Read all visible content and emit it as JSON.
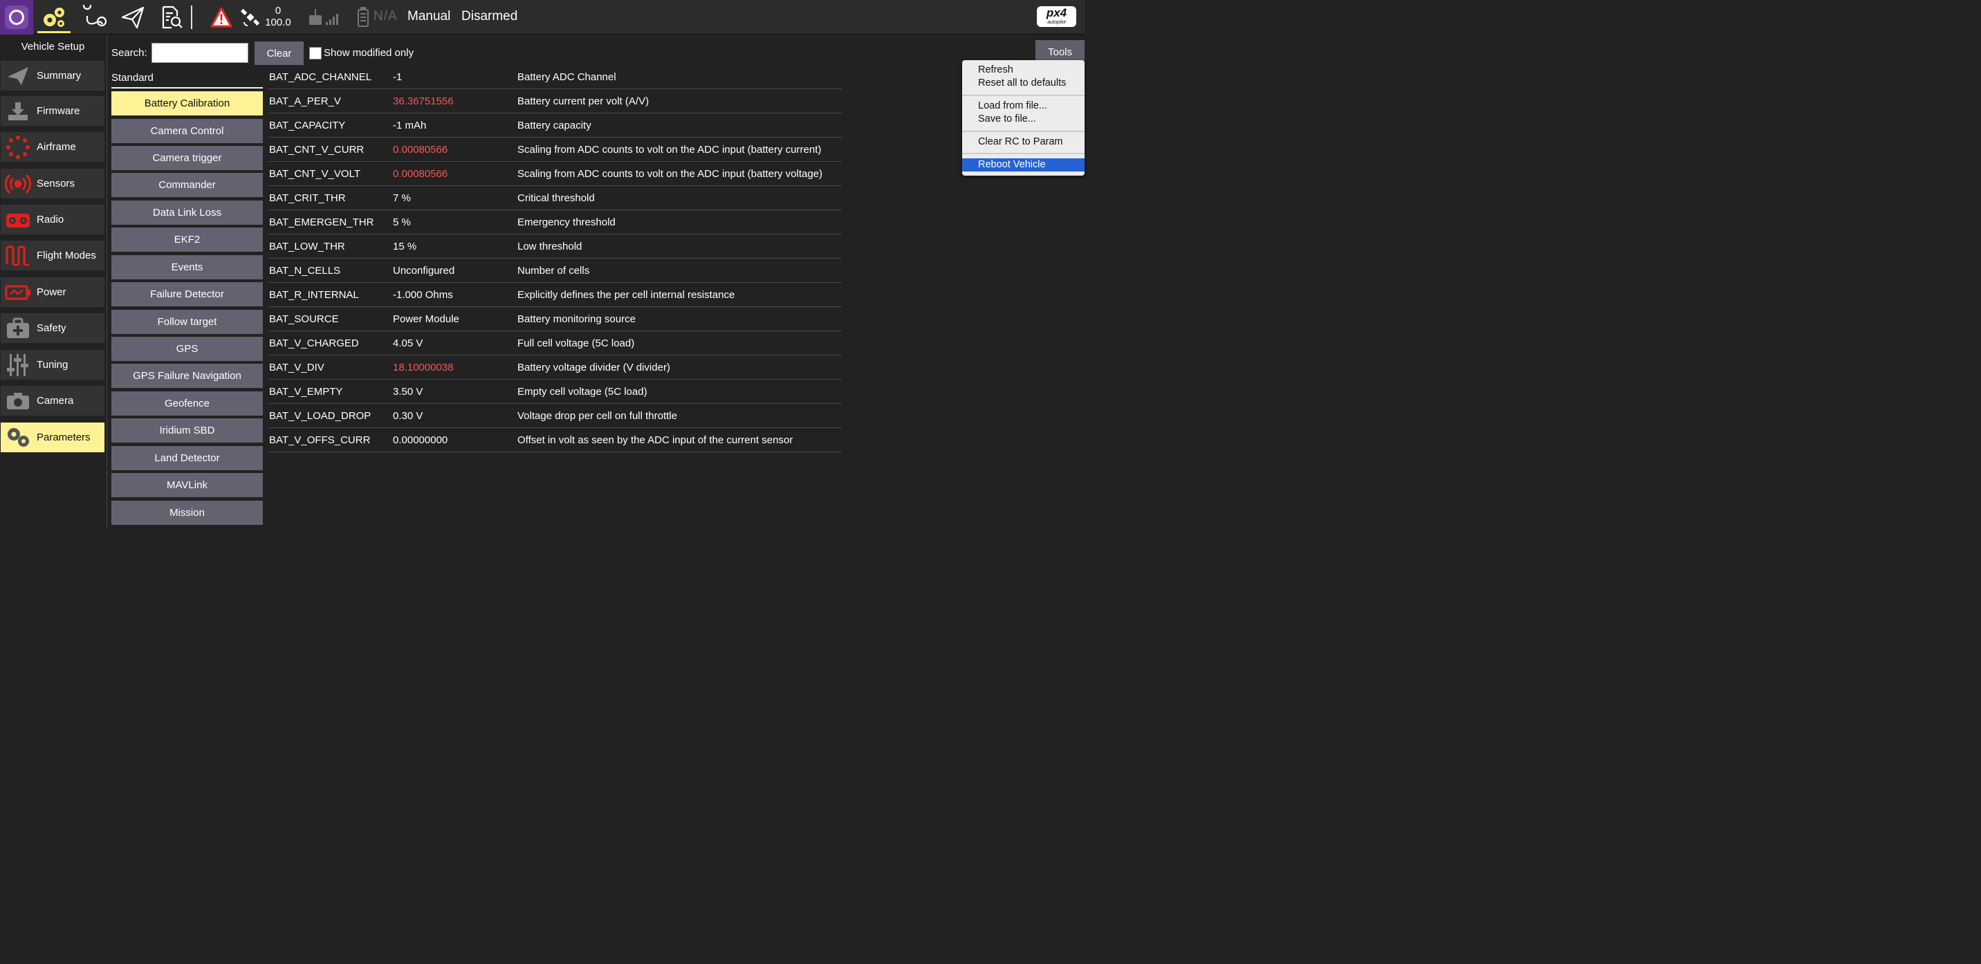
{
  "toolbar": {
    "gps_count": "0",
    "gps_hdop": "100.0",
    "battery_text": "N/A",
    "flight_mode": "Manual",
    "arm_state": "Disarmed",
    "logo_text": "px4",
    "logo_subtext": "autopilot",
    "icons": [
      "qgc-logo-icon",
      "vehicle-setup-gears-icon",
      "plan-view-icon",
      "fly-view-paper-plane-icon",
      "analyze-view-icon",
      "warning-icon",
      "gps-satellite-icon",
      "rc-transmitter-icon",
      "battery-icon"
    ]
  },
  "setup": {
    "title": "Vehicle Setup",
    "items": [
      {
        "label": "Summary",
        "icon": "paper-plane-icon"
      },
      {
        "label": "Firmware",
        "icon": "download-icon"
      },
      {
        "label": "Airframe",
        "icon": "airframe-icon"
      },
      {
        "label": "Sensors",
        "icon": "sensors-icon"
      },
      {
        "label": "Radio",
        "icon": "radio-icon"
      },
      {
        "label": "Flight Modes",
        "icon": "flight-modes-icon"
      },
      {
        "label": "Power",
        "icon": "power-battery-icon"
      },
      {
        "label": "Safety",
        "icon": "safety-kit-icon"
      },
      {
        "label": "Tuning",
        "icon": "tuning-sliders-icon"
      },
      {
        "label": "Camera",
        "icon": "camera-icon"
      },
      {
        "label": "Parameters",
        "icon": "parameters-gears-icon"
      }
    ],
    "active": "Parameters"
  },
  "search": {
    "label": "Search:",
    "value": "",
    "clear_label": "Clear",
    "modified_only_label": "Show modified only",
    "modified_only_checked": false
  },
  "tools": {
    "button_label": "Tools",
    "menu": [
      {
        "label": "Refresh"
      },
      {
        "label": "Reset all to defaults"
      },
      {
        "label": "Load from file..."
      },
      {
        "label": "Save to file..."
      },
      {
        "label": "Clear RC to Param"
      },
      {
        "label": "Reboot Vehicle",
        "selected": true
      }
    ]
  },
  "groups": {
    "header": "Standard",
    "items": [
      "Battery Calibration",
      "Camera Control",
      "Camera trigger",
      "Commander",
      "Data Link Loss",
      "EKF2",
      "Events",
      "Failure Detector",
      "Follow target",
      "GPS",
      "GPS Failure Navigation",
      "Geofence",
      "Iridium SBD",
      "Land Detector",
      "MAVLink",
      "Mission"
    ],
    "active": "Battery Calibration"
  },
  "params": [
    {
      "name": "BAT_ADC_CHANNEL",
      "value": "-1",
      "desc": "Battery ADC Channel",
      "modified": false
    },
    {
      "name": "BAT_A_PER_V",
      "value": "36.36751556",
      "desc": "Battery current per volt (A/V)",
      "modified": true
    },
    {
      "name": "BAT_CAPACITY",
      "value": "-1 mAh",
      "desc": "Battery capacity",
      "modified": false
    },
    {
      "name": "BAT_CNT_V_CURR",
      "value": "0.00080566",
      "desc": "Scaling from ADC counts to volt on the ADC input (battery current)",
      "modified": true
    },
    {
      "name": "BAT_CNT_V_VOLT",
      "value": "0.00080566",
      "desc": "Scaling from ADC counts to volt on the ADC input (battery voltage)",
      "modified": true
    },
    {
      "name": "BAT_CRIT_THR",
      "value": "7 %",
      "desc": "Critical threshold",
      "modified": false
    },
    {
      "name": "BAT_EMERGEN_THR",
      "value": "5 %",
      "desc": "Emergency threshold",
      "modified": false
    },
    {
      "name": "BAT_LOW_THR",
      "value": "15 %",
      "desc": "Low threshold",
      "modified": false
    },
    {
      "name": "BAT_N_CELLS",
      "value": "Unconfigured",
      "desc": "Number of cells",
      "modified": false
    },
    {
      "name": "BAT_R_INTERNAL",
      "value": "-1.000 Ohms",
      "desc": "Explicitly defines the per cell internal resistance",
      "modified": false
    },
    {
      "name": "BAT_SOURCE",
      "value": "Power Module",
      "desc": "Battery monitoring source",
      "modified": false
    },
    {
      "name": "BAT_V_CHARGED",
      "value": "4.05 V",
      "desc": "Full cell voltage (5C load)",
      "modified": false
    },
    {
      "name": "BAT_V_DIV",
      "value": "18.10000038",
      "desc": "Battery voltage divider (V divider)",
      "modified": true
    },
    {
      "name": "BAT_V_EMPTY",
      "value": "3.50 V",
      "desc": "Empty cell voltage (5C load)",
      "modified": false
    },
    {
      "name": "BAT_V_LOAD_DROP",
      "value": "0.30 V",
      "desc": "Voltage drop per cell on full throttle",
      "modified": false
    },
    {
      "name": "BAT_V_OFFS_CURR",
      "value": "0.00000000",
      "desc": "Offset in volt as seen by the ADC input of the current sensor",
      "modified": false
    }
  ],
  "colors": {
    "active_highlight": "#fdf296",
    "modified_value": "#ee5b5b",
    "button_bg": "#626270",
    "menu_selection": "#2562d4",
    "toolbar_bg": "#2c2c2c",
    "logo_purple": "#5b2f87"
  }
}
